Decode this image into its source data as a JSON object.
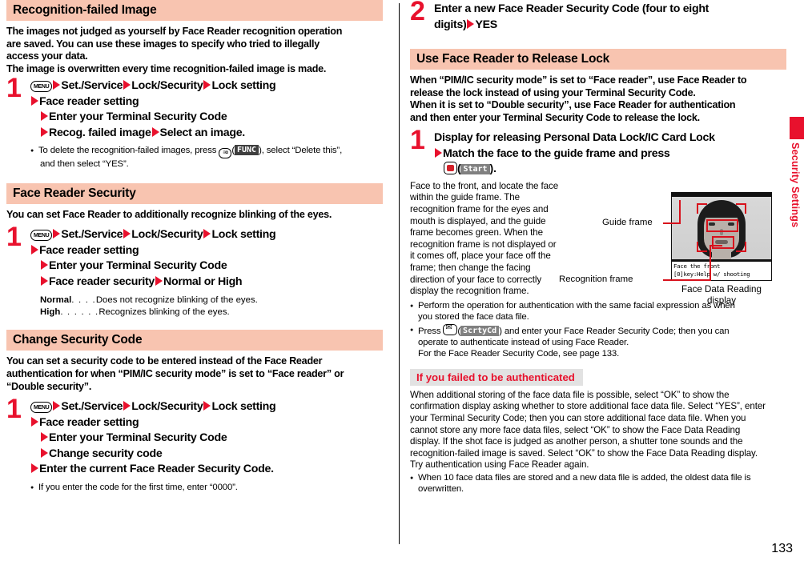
{
  "page": {
    "number": "133",
    "side_tab_label": "Security Settings",
    "accent_red": "#e8112d",
    "heading_bg": "#f8c4b0",
    "subhead_bg": "#e2e2e2"
  },
  "left_column": {
    "sections": [
      {
        "heading": "Recognition-failed Image",
        "lead_lines": [
          "The images not judged as yourself by Face Reader recognition operation",
          "are saved. You can use these images to specify who tried to illegally",
          "access your data.",
          "The image is overwritten every time recognition-failed image is made."
        ],
        "step": {
          "number": "1",
          "key_icon": "menu-key-icon",
          "key_label": "MENU",
          "lines": [
            [
              "Set./Service",
              "Lock/Security",
              "Lock setting"
            ],
            [
              "Face reader setting"
            ],
            [
              "Enter your Terminal Security Code"
            ],
            [
              "Recog. failed image",
              "Select an image."
            ]
          ]
        },
        "bullets": [
          {
            "pre": "To delete the recognition-failed images, press ",
            "key_icon": "i-mode-func-key-icon",
            "softkey": "FUNC",
            "post": "), select “Delete this”,",
            "second_line": "and then select “YES”."
          }
        ]
      },
      {
        "heading": "Face Reader Security",
        "lead_lines": [
          "You can set Face Reader to additionally recognize blinking of the eyes."
        ],
        "step": {
          "number": "1",
          "key_icon": "menu-key-icon",
          "key_label": "MENU",
          "lines": [
            [
              "Set./Service",
              "Lock/Security",
              "Lock setting"
            ],
            [
              "Face reader setting"
            ],
            [
              "Enter your Terminal Security Code"
            ],
            [
              "Face reader security",
              "Normal or High"
            ]
          ]
        },
        "definitions": [
          {
            "term": "Normal",
            "dots": ". . . .",
            "desc": "Does not recognize blinking of the eyes."
          },
          {
            "term": "High",
            "dots": ". . . . . .",
            "desc": "Recognizes blinking of the eyes."
          }
        ]
      },
      {
        "heading": "Change Security Code",
        "lead_lines": [
          "You can set a security code to be entered instead of the Face Reader",
          "authentication for when “PIM/IC security mode” is set to “Face reader” or",
          "“Double security”."
        ],
        "step": {
          "number": "1",
          "key_icon": "menu-key-icon",
          "key_label": "MENU",
          "lines": [
            [
              "Set./Service",
              "Lock/Security",
              "Lock setting"
            ],
            [
              "Face reader setting"
            ],
            [
              "Enter your Terminal Security Code"
            ],
            [
              "Change security code"
            ],
            [
              "Enter the current Face Reader Security Code."
            ]
          ]
        },
        "bullets": [
          {
            "pre": "If you enter the code for the first time, enter “0000”."
          }
        ]
      }
    ]
  },
  "right_column": {
    "top_step": {
      "number": "2",
      "line1": "Enter a new Face Reader Security Code (four to eight",
      "line2_pre": "digits)",
      "line2_post": "YES"
    },
    "section": {
      "heading": "Use Face Reader to Release Lock",
      "lead_lines": [
        "When “PIM/IC security mode” is set to “Face reader”, use Face Reader to",
        "release the lock instead of using your Terminal Security Code.",
        "When it is set to “Double security”, use Face Reader for authentication",
        "and then enter your Terminal Security Code to release the lock."
      ],
      "step": {
        "number": "1",
        "line1": "Display for releasing Personal Data Lock/IC Card Lock",
        "line2": "Match the face to the guide frame and press",
        "line3_key_icon": "center-key-icon",
        "line3_softkey": "Start",
        "line3_suffix": ")."
      },
      "body_paragraph_lines": [
        "Face to the front, and locate the face",
        "within the guide frame. The",
        "recognition frame for the eyes and",
        "mouth is displayed, and the guide",
        "frame becomes green. When the",
        "recognition frame is not displayed or",
        "it comes off, place your face off the",
        "frame; then change the facing",
        "direction of your face to correctly",
        "display the recognition frame."
      ],
      "bullets": [
        {
          "lines": [
            "Perform the operation for authentication with the same facial expression as when",
            "you stored the face data file."
          ]
        },
        {
          "pre": "Press ",
          "key_icon": "mail-key-icon",
          "softkey": "ScrtyCd",
          "post": ") and enter your Face Reader Security Code; then you can",
          "lines": [
            "operate to authenticate instead of using Face Reader.",
            "For the Face Reader Security Code, see page 133."
          ]
        }
      ]
    },
    "figure": {
      "callout_guide": "Guide frame",
      "callout_recognition": "Recognition frame",
      "screen_line1": "Face the front",
      "screen_line2": "[0]key:Help w/ shooting",
      "caption_line1": "Face Data Reading",
      "caption_line2": "display"
    },
    "subsection": {
      "heading": "If you failed to be authenticated",
      "paragraph_lines": [
        "When additional storing of the face data file is possible, select “OK” to show the",
        "confirmation display asking whether to store additional face data file. Select “YES”, enter",
        "your Terminal Security Code; then you can store additional face data file. When you",
        "cannot store any more face data files, select “OK” to show the Face Data Reading",
        "display. If the shot face is judged as another person, a shutter tone sounds and the",
        "recognition-failed image is saved. Select “OK” to show the Face Data Reading display.",
        "Try authentication using Face Reader again."
      ],
      "bullets": [
        {
          "lines": [
            "When 10 face data files are stored and a new data file is added, the oldest data file is",
            "overwritten."
          ]
        }
      ]
    }
  }
}
